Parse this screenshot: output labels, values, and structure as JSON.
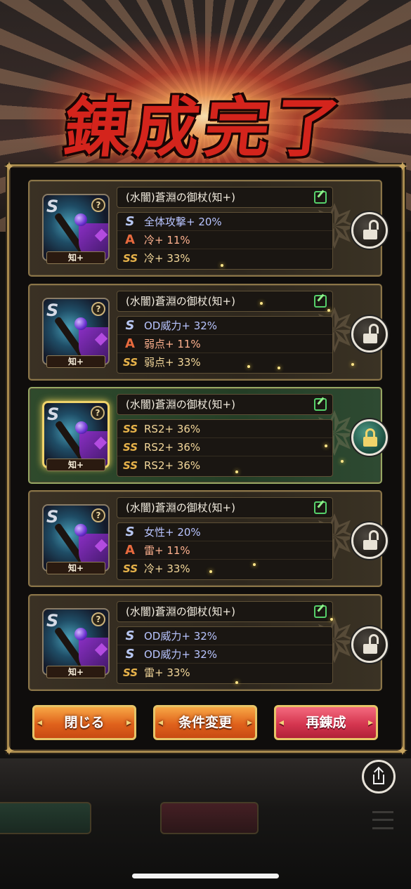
{
  "title": "錬成完了",
  "weapon_tag": "知+",
  "cards": [
    {
      "name": "(水闇)蒼淵の御杖(知+)",
      "locked": false,
      "stats": [
        {
          "icon": "S",
          "type": "s",
          "text": "全体攻撃+ 20%"
        },
        {
          "icon": "A",
          "type": "a",
          "text": "冷+ 11%"
        },
        {
          "icon": "SS",
          "type": "ss",
          "text": "冷+ 33%"
        }
      ]
    },
    {
      "name": "(水闇)蒼淵の御杖(知+)",
      "locked": false,
      "stats": [
        {
          "icon": "S",
          "type": "s",
          "text": "OD威力+ 32%"
        },
        {
          "icon": "A",
          "type": "a",
          "text": "弱点+ 11%"
        },
        {
          "icon": "SS",
          "type": "ss",
          "text": "弱点+ 33%"
        }
      ]
    },
    {
      "name": "(水闇)蒼淵の御杖(知+)",
      "locked": true,
      "stats": [
        {
          "icon": "SS",
          "type": "ss",
          "text": "RS2+ 36%"
        },
        {
          "icon": "SS",
          "type": "ss",
          "text": "RS2+ 36%"
        },
        {
          "icon": "SS",
          "type": "ss",
          "text": "RS2+ 36%"
        }
      ]
    },
    {
      "name": "(水闇)蒼淵の御杖(知+)",
      "locked": false,
      "stats": [
        {
          "icon": "S",
          "type": "s",
          "text": "女性+ 20%"
        },
        {
          "icon": "A",
          "type": "a",
          "text": "雷+ 11%"
        },
        {
          "icon": "SS",
          "type": "ss",
          "text": "冷+ 33%"
        }
      ]
    },
    {
      "name": "(水闇)蒼淵の御杖(知+)",
      "locked": false,
      "stats": [
        {
          "icon": "S",
          "type": "s",
          "text": "OD威力+ 32%"
        },
        {
          "icon": "S",
          "type": "s",
          "text": "OD威力+ 32%"
        },
        {
          "icon": "SS",
          "type": "ss",
          "text": "雷+ 33%"
        }
      ]
    }
  ],
  "buttons": {
    "close": "閉じる",
    "change_conditions": "条件変更",
    "refine_again": "再錬成"
  }
}
